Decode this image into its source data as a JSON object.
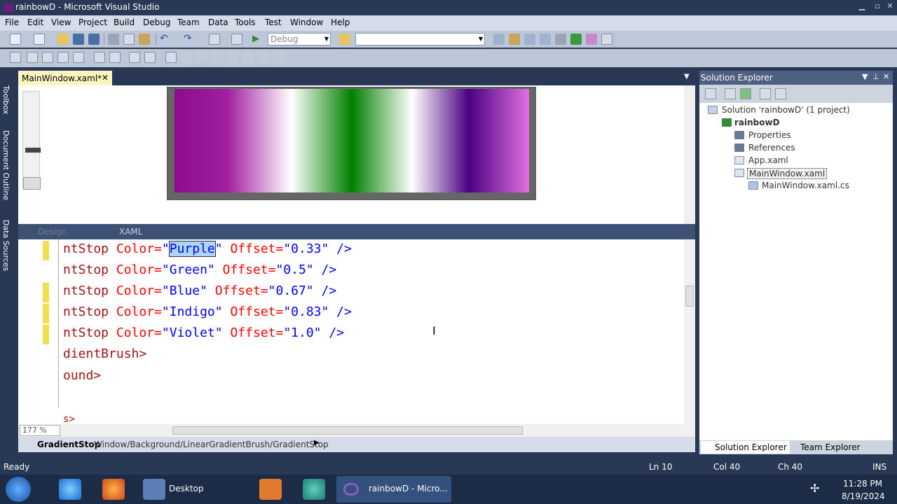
{
  "window": {
    "title": "rainbowD - Microsoft Visual Studio"
  },
  "menu": [
    "File",
    "Edit",
    "View",
    "Project",
    "Build",
    "Debug",
    "Team",
    "Data",
    "Tools",
    "Test",
    "Window",
    "Help"
  ],
  "toolbar": {
    "config_value": "Debug",
    "platform_value": ""
  },
  "left_rail": [
    "Toolbox",
    "Document Outline",
    "Data Sources"
  ],
  "doc_tab": {
    "label": "MainWindow.xaml*",
    "close": "✕"
  },
  "splitter": {
    "design_tab": "Design",
    "xaml_tab": "XAML"
  },
  "code_lines": [
    {
      "pre": "ntStop",
      "attr1": " Color=",
      "val1q1": "\"",
      "val1": "Purple",
      "val1q2": "\"",
      "attr2": " Offset=",
      "val2": "\"0.33\"",
      "end": " />"
    },
    {
      "pre": "ntStop",
      "attr1": " Color=",
      "val1q1": "\"",
      "val1": "Green",
      "val1q2": "\"",
      "attr2": " Offset=",
      "val2": "\"0.5\"",
      "end": " />"
    },
    {
      "pre": "ntStop",
      "attr1": " Color=",
      "val1q1": "\"",
      "val1": "Blue",
      "val1q2": "\"",
      "attr2": " Offset=",
      "val2": "\"0.67\"",
      "end": " />"
    },
    {
      "pre": "ntStop",
      "attr1": " Color=",
      "val1q1": "\"",
      "val1": "Indigo",
      "val1q2": "\"",
      "attr2": " Offset=",
      "val2": "\"0.83\"",
      "end": " />"
    },
    {
      "pre": "ntStop",
      "attr1": " Color=",
      "val1q1": "\"",
      "val1": "Violet",
      "val1q2": "\"",
      "attr2": " Offset=",
      "val2": "\"1.0\"",
      "end": " />"
    }
  ],
  "code_tail": [
    "dientBrush>",
    "ound>",
    "s>"
  ],
  "zoom": "177 %",
  "breadcrumb": {
    "element": "GradientStop",
    "path": "Window/Background/LinearGradientBrush/GradientStop"
  },
  "solution_explorer": {
    "title": "Solution Explorer",
    "solution": "Solution 'rainbowD' (1 project)",
    "project": "rainbowD",
    "items": [
      "Properties",
      "References",
      "App.xaml",
      "MainWindow.xaml",
      "MainWindow.xaml.cs"
    ]
  },
  "bottom_tabs": [
    "Solution Explorer",
    "Team Explorer"
  ],
  "status": {
    "ready": "Ready",
    "ln": "Ln 10",
    "col": "Col 40",
    "ch": "Ch 40",
    "mode": "INS"
  },
  "taskbar": {
    "desktop": "Desktop",
    "vs_task": "rainbowD - Micro...",
    "time": "11:28 PM",
    "date": "8/19/2024"
  },
  "colors": {
    "chrome": "#293955",
    "doc_tab": "#fdf4bf",
    "menu": "#d6dbe9",
    "accent_purple": "#68217a"
  }
}
